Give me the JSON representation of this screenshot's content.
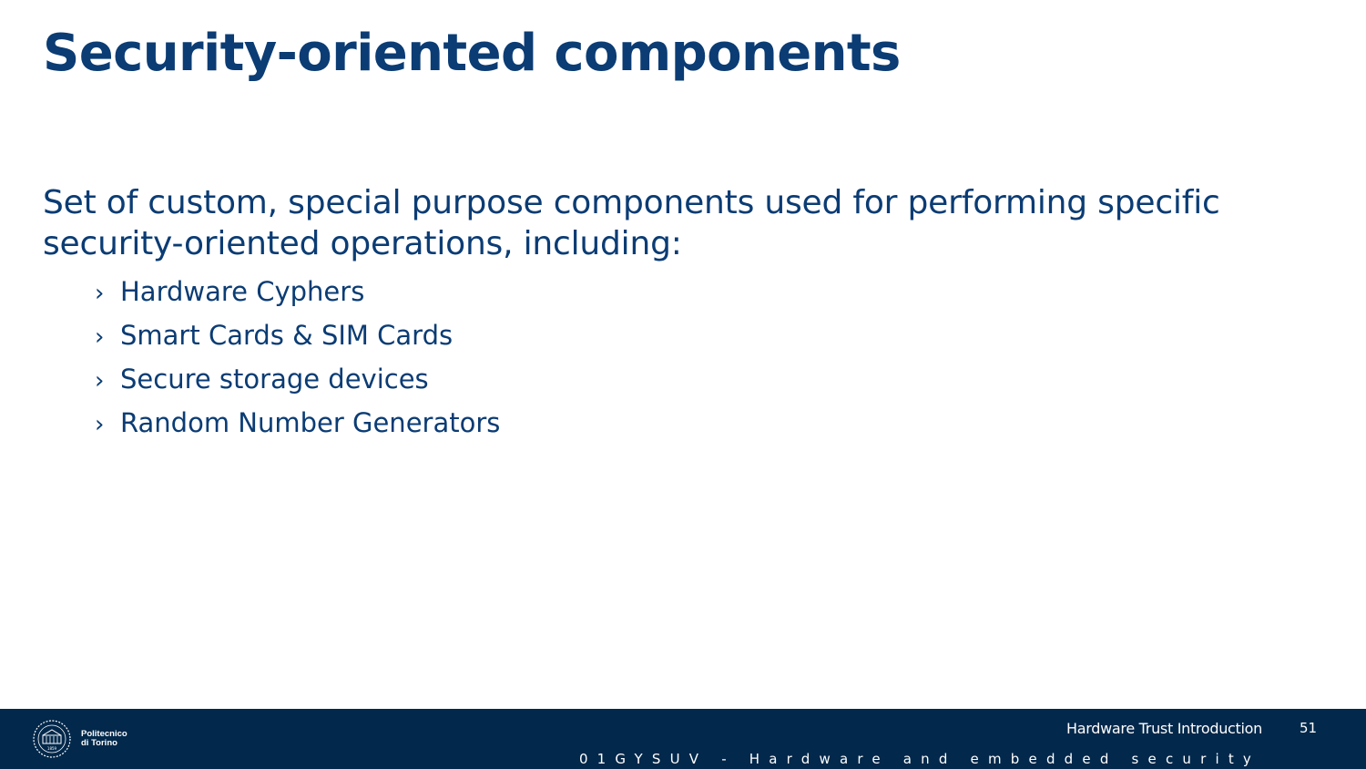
{
  "slide": {
    "title": "Security-oriented components",
    "intro": "Set of custom, special purpose components used for performing specific security-oriented operations, including:",
    "bullet_marker": "›",
    "bullets": [
      "Hardware Cyphers",
      "Smart Cards & SIM Cards",
      "Secure storage devices",
      "Random Number Generators"
    ]
  },
  "footer": {
    "logo_line1": "Politecnico",
    "logo_line2": "di Torino",
    "logo_year": "1859",
    "lecture_title": "Hardware Trust Introduction",
    "page_number": "51",
    "course": "01GYSUV - Hardware and embedded security"
  },
  "colors": {
    "title": "#0b3c74",
    "body_text": "#0b3c74",
    "footer_background": "#02284b",
    "footer_text": "#ffffff"
  }
}
